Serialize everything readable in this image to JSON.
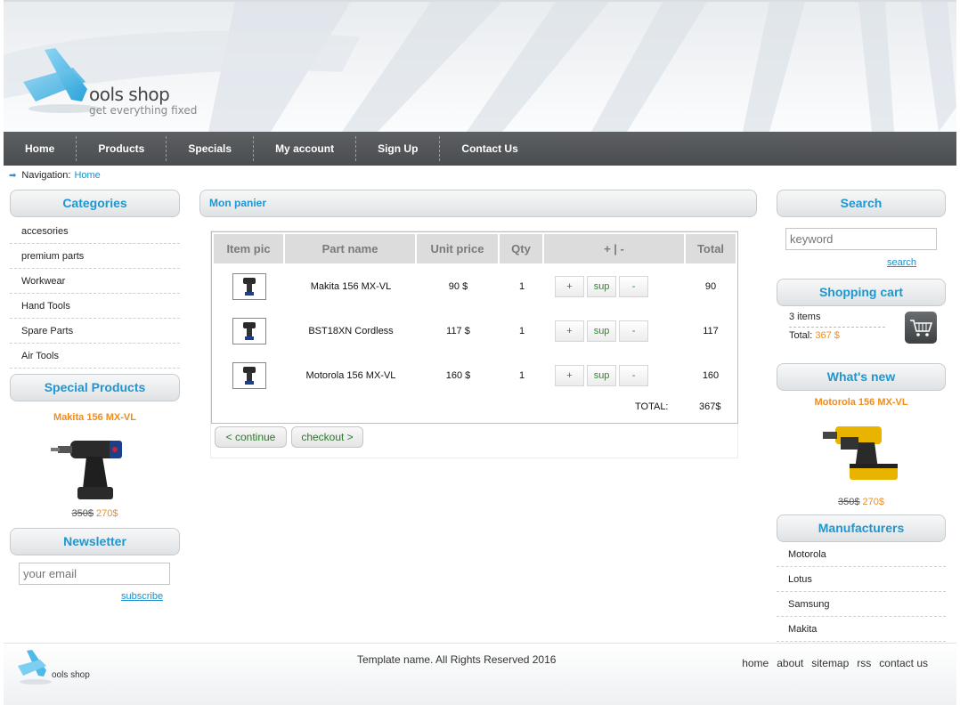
{
  "site": {
    "logo_text": "ools shop",
    "tagline": "get everything fixed"
  },
  "nav": [
    "Home",
    "Products",
    "Specials",
    "My account",
    "Sign Up",
    "Contact Us"
  ],
  "breadcrumb": {
    "label": "Navigation:",
    "current": "Home"
  },
  "categories": {
    "title": "Categories",
    "items": [
      "accesories",
      "premium parts",
      "Workwear",
      "Hand Tools",
      "Spare Parts",
      "Air Tools"
    ]
  },
  "special": {
    "title": "Special Products",
    "name": "Makita 156 MX-VL",
    "old_price": "350$",
    "new_price": "270$"
  },
  "newsletter": {
    "title": "Newsletter",
    "placeholder": "your email",
    "subscribe": "subscribe"
  },
  "cart": {
    "title": "Mon panier",
    "headers": [
      "Item pic",
      "Part name",
      "Unit price",
      "Qty",
      "+ | -",
      "Total"
    ],
    "rows": [
      {
        "name": "Makita 156 MX-VL",
        "price": "90 $",
        "qty": "1",
        "total": "90"
      },
      {
        "name": "BST18XN Cordless",
        "price": "117 $",
        "qty": "1",
        "total": "117"
      },
      {
        "name": "Motorola 156 MX-VL",
        "price": "160 $",
        "qty": "1",
        "total": "160"
      }
    ],
    "btn_plus": "+",
    "btn_sup": "sup",
    "btn_minus": "-",
    "total_label": "TOTAL:",
    "total_value": "367$",
    "continue": "< continue",
    "checkout": "checkout >"
  },
  "search": {
    "title": "Search",
    "placeholder": "keyword",
    "button": "search"
  },
  "shopping_cart": {
    "title": "Shopping cart",
    "items": "3 items",
    "total_label": "Total:",
    "total_value": "367 $"
  },
  "whats_new": {
    "title": "What's new",
    "name": "Motorola 156 MX-VL",
    "old_price": "350$",
    "new_price": "270$"
  },
  "manufacturers": {
    "title": "Manufacturers",
    "items": [
      "Motorola",
      "Lotus",
      "Samsung",
      "Makita"
    ]
  },
  "footer": {
    "logo_text": "ools shop",
    "copyright": "Template name. All Rights Reserved 2016",
    "links": [
      "home",
      "about",
      "sitemap",
      "rss",
      "contact us"
    ]
  },
  "colors": {
    "accent_blue": "#1f96cf",
    "accent_orange": "#f08c1a",
    "nav_bg": "#4a4d50"
  }
}
